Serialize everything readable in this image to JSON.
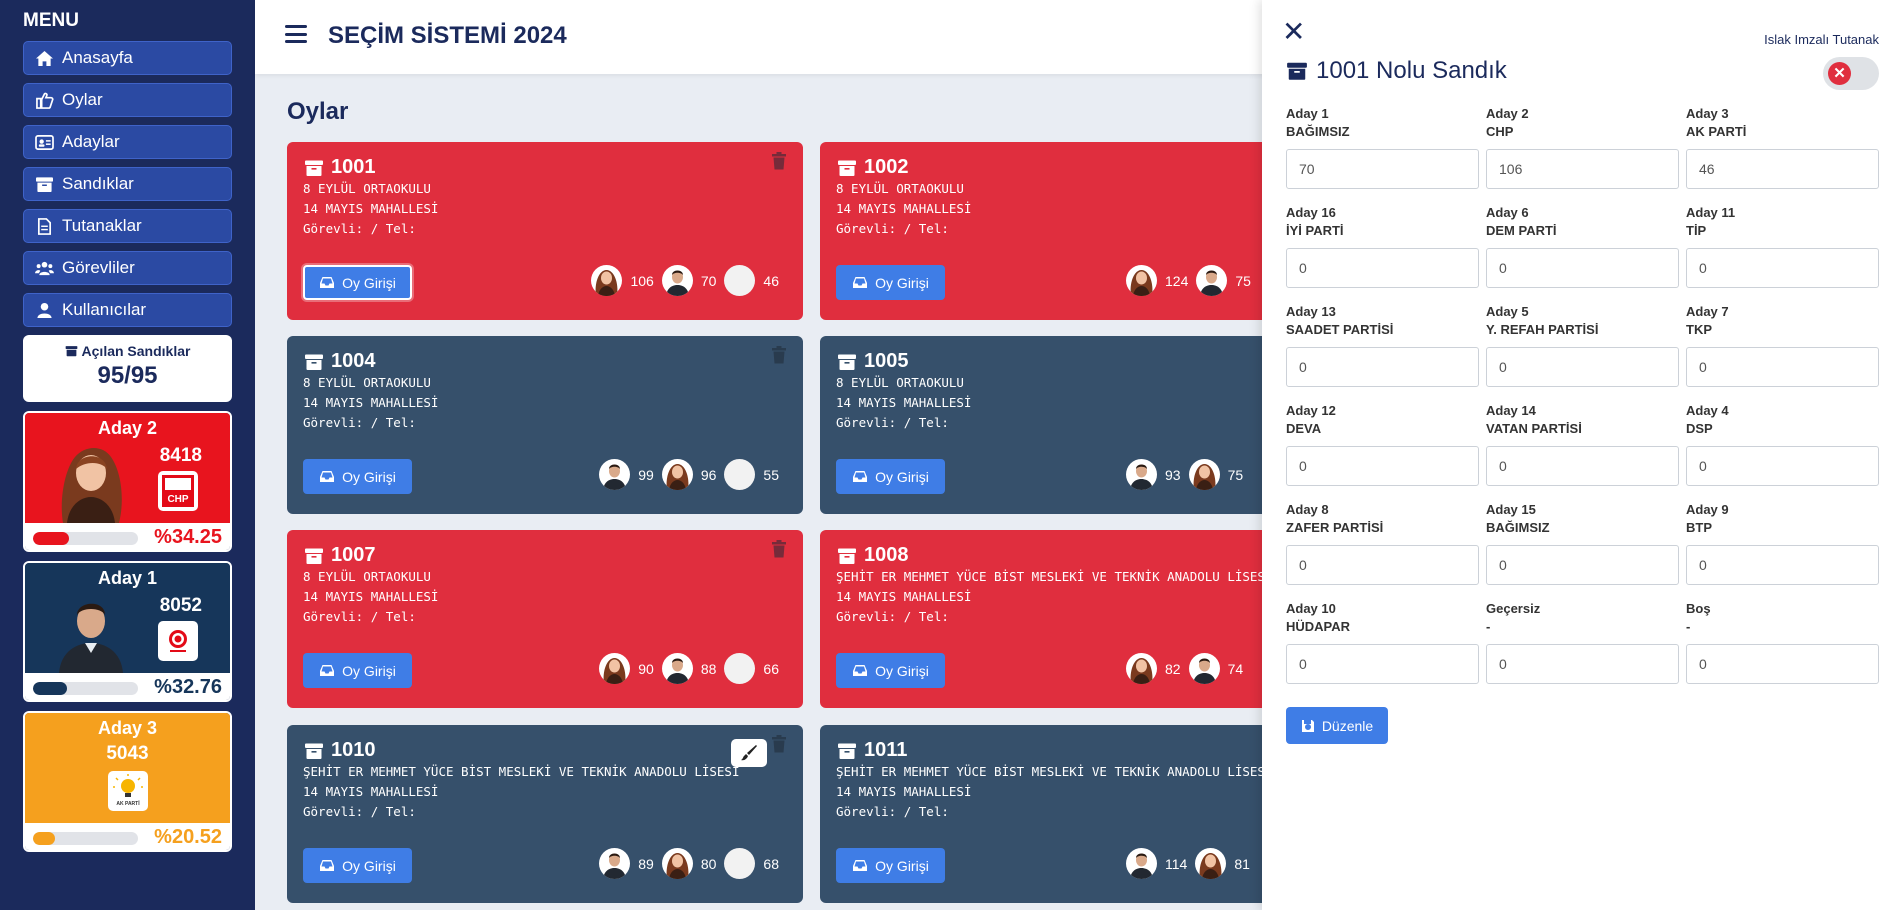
{
  "app": {
    "title": "SEÇİM SİSTEMİ 2024"
  },
  "sidebar": {
    "menu_title": "MENU",
    "items": [
      {
        "label": "Anasayfa",
        "icon": "home-icon"
      },
      {
        "label": "Oylar",
        "icon": "vote-icon"
      },
      {
        "label": "Adaylar",
        "icon": "id-card-icon"
      },
      {
        "label": "Sandıklar",
        "icon": "archive-box-icon"
      },
      {
        "label": "Tutanaklar",
        "icon": "document-icon"
      },
      {
        "label": "Görevliler",
        "icon": "users-icon"
      },
      {
        "label": "Kullanıcılar",
        "icon": "user-icon"
      }
    ],
    "opened": {
      "label": "Açılan Sandıklar",
      "value": "95/95"
    },
    "candidates": [
      {
        "name": "Aday 2",
        "votes": "8418",
        "percent": "%34.25",
        "fraction": 0.3425,
        "color": "#e8141e",
        "party_logo": "CHP"
      },
      {
        "name": "Aday 1",
        "votes": "8052",
        "percent": "%32.76",
        "fraction": 0.3276,
        "color": "#16365a",
        "party_logo": "party-emblem"
      },
      {
        "name": "Aday 3",
        "votes": "5043",
        "percent": "%20.52",
        "fraction": 0.2052,
        "color": "#f5a01e",
        "party_logo": "AK PARTİ"
      }
    ]
  },
  "main": {
    "page_title": "Oylar",
    "oy_button": "Oy Girişi",
    "cards": [
      {
        "no": "1001",
        "school": "8 EYLÜL ORTAOKULU",
        "mahalle": "14 MAYIS MAHALLESİ",
        "gorevli": "Görevli: / Tel:",
        "color": "red",
        "v": [
          "106",
          "70",
          "46"
        ]
      },
      {
        "no": "1002",
        "school": "8 EYLÜL ORTAOKULU",
        "mahalle": "14 MAYIS MAHALLESİ",
        "gorevli": "Görevli: / Tel:",
        "color": "red",
        "v": [
          "124",
          "75"
        ]
      },
      {
        "no": "1004",
        "school": "8 EYLÜL ORTAOKULU",
        "mahalle": "14 MAYIS MAHALLESİ",
        "gorevli": "Görevli: / Tel:",
        "color": "dark",
        "v": [
          "99",
          "96",
          "55"
        ]
      },
      {
        "no": "1005",
        "school": "8 EYLÜL ORTAOKULU",
        "mahalle": "14 MAYIS MAHALLESİ",
        "gorevli": "Görevli: / Tel:",
        "color": "dark",
        "v": [
          "93",
          "75"
        ]
      },
      {
        "no": "1007",
        "school": "8 EYLÜL ORTAOKULU",
        "mahalle": "14 MAYIS MAHALLESİ",
        "gorevli": "Görevli: / Tel:",
        "color": "red",
        "v": [
          "90",
          "88",
          "66"
        ]
      },
      {
        "no": "1008",
        "school": "ŞEHİT ER MEHMET YÜCE BİST MESLEKİ VE TEKNİK ANADOLU LİSESİ",
        "mahalle": "14 MAYIS MAHALLESİ",
        "gorevli": "Görevli: / Tel:",
        "color": "red",
        "v": [
          "82",
          "74"
        ]
      },
      {
        "no": "1010",
        "school": "ŞEHİT ER MEHMET YÜCE BİST MESLEKİ VE TEKNİK ANADOLU LİSESİ",
        "mahalle": "14 MAYIS MAHALLESİ",
        "gorevli": "Görevli: / Tel:",
        "color": "dark",
        "v": [
          "89",
          "80",
          "68"
        ]
      },
      {
        "no": "1011",
        "school": "ŞEHİT ER MEHMET YÜCE BİST MESLEKİ VE TEKNİK ANADOLU LİSESİ",
        "mahalle": "14 MAYIS MAHALLESİ",
        "gorevli": "Görevli: / Tel:",
        "color": "dark",
        "v": [
          "114",
          "81"
        ]
      }
    ]
  },
  "panel": {
    "title": "1001 Nolu Sandık",
    "islak": "Islak Imzalı Tutanak",
    "save": "Düzenle",
    "fields": [
      {
        "l1": "Aday 1",
        "l2": "BAĞIMSIZ",
        "value": "70"
      },
      {
        "l1": "Aday 2",
        "l2": "CHP",
        "value": "106"
      },
      {
        "l1": "Aday 3",
        "l2": "AK PARTİ",
        "value": "46"
      },
      {
        "l1": "Aday 16",
        "l2": "İYİ PARTİ",
        "value": "0"
      },
      {
        "l1": "Aday 6",
        "l2": "DEM PARTİ",
        "value": "0"
      },
      {
        "l1": "Aday 11",
        "l2": "TİP",
        "value": "0"
      },
      {
        "l1": "Aday 13",
        "l2": "SAADET PARTİSİ",
        "value": "0"
      },
      {
        "l1": "Aday 5",
        "l2": "Y. REFAH PARTİSİ",
        "value": "0"
      },
      {
        "l1": "Aday 7",
        "l2": "TKP",
        "value": "0"
      },
      {
        "l1": "Aday 12",
        "l2": "DEVA",
        "value": "0"
      },
      {
        "l1": "Aday 14",
        "l2": "VATAN PARTİSİ",
        "value": "0"
      },
      {
        "l1": "Aday 4",
        "l2": "DSP",
        "value": "0"
      },
      {
        "l1": "Aday 8",
        "l2": "ZAFER PARTİSİ",
        "value": "0"
      },
      {
        "l1": "Aday 15",
        "l2": "BAĞIMSIZ",
        "value": "0"
      },
      {
        "l1": "Aday 9",
        "l2": "BTP",
        "value": "0"
      },
      {
        "l1": "Aday 10",
        "l2": "HÜDAPAR",
        "value": "0"
      },
      {
        "l1": "Geçersiz",
        "l2": "-",
        "value": "0"
      },
      {
        "l1": "Boş",
        "l2": "-",
        "value": "0"
      }
    ]
  }
}
